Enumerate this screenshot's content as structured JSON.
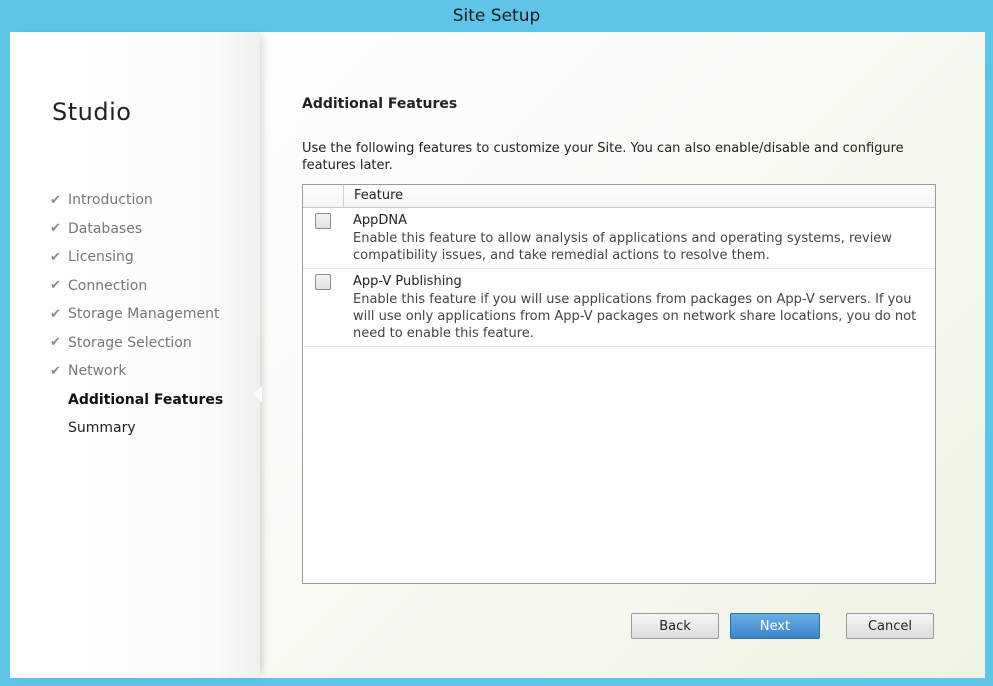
{
  "window": {
    "title": "Site Setup"
  },
  "sidebar": {
    "brand": "Studio",
    "steps": [
      {
        "label": "Introduction",
        "state": "done"
      },
      {
        "label": "Databases",
        "state": "done"
      },
      {
        "label": "Licensing",
        "state": "done"
      },
      {
        "label": "Connection",
        "state": "done"
      },
      {
        "label": "Storage Management",
        "state": "done"
      },
      {
        "label": "Storage Selection",
        "state": "done"
      },
      {
        "label": "Network",
        "state": "done"
      },
      {
        "label": "Additional Features",
        "state": "current"
      },
      {
        "label": "Summary",
        "state": "pending"
      }
    ],
    "check_glyph": "✔"
  },
  "main": {
    "heading": "Additional Features",
    "description": "Use the following features to customize your Site.  You can also enable/disable and configure features later.",
    "table": {
      "column_header": "Feature",
      "rows": [
        {
          "name": "AppDNA",
          "description": "Enable this feature to allow analysis of applications and operating systems, review compatibility issues, and take remedial actions to resolve them.",
          "checked": false
        },
        {
          "name": "App-V Publishing",
          "description": "Enable this feature if you will use applications from packages on App-V servers. If you will use only applications from App-V packages on network share locations, you do not need to enable this feature.",
          "checked": false
        }
      ]
    }
  },
  "footer": {
    "back_label": "Back",
    "next_label": "Next",
    "cancel_label": "Cancel"
  },
  "colors": {
    "frame": "#5ec4e8",
    "primary_button": "#3b86c8"
  }
}
